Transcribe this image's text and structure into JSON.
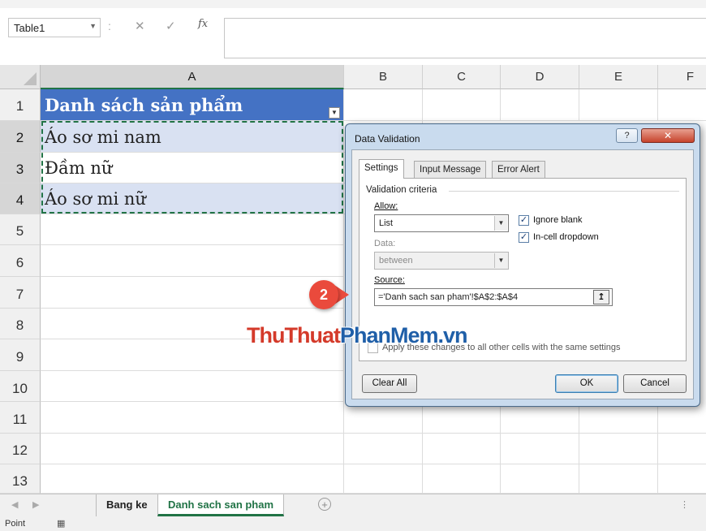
{
  "formula_bar": {
    "name_box": "Table1",
    "separator": ":",
    "cancel_glyph": "✕",
    "enter_glyph": "✓",
    "fx_label": "fx",
    "formula": ""
  },
  "columns": [
    "A",
    "B",
    "C",
    "D",
    "E",
    "F"
  ],
  "rows": [
    "1",
    "2",
    "3",
    "4",
    "5",
    "6",
    "7",
    "8",
    "9",
    "10",
    "11",
    "12",
    "13"
  ],
  "cells": {
    "a1": "Danh sách sản phẩm",
    "a2": "Áo sơ mi nam",
    "a3": "Đầm nữ",
    "a4": "Áo sơ mi nữ"
  },
  "sheet_tabs": [
    "Bang ke",
    "Danh sach san pham"
  ],
  "status": {
    "mode": "Point"
  },
  "dialog": {
    "title": "Data Validation",
    "help": "?",
    "close": "✕",
    "tabs": [
      "Settings",
      "Input Message",
      "Error Alert"
    ],
    "group_label": "Validation criteria",
    "allow_label": "Allow:",
    "allow_value": "List",
    "ignore_blank": "Ignore blank",
    "in_cell_dropdown": "In-cell dropdown",
    "data_label": "Data:",
    "data_value": "between",
    "source_label": "Source:",
    "source_value": "='Danh sach san pham'!$A$2:$A$4",
    "apply_label": "Apply these changes to all other cells with the same settings",
    "clear_all": "Clear All",
    "ok": "OK",
    "cancel": "Cancel"
  },
  "annotation": {
    "step": "2"
  },
  "watermark": {
    "part1": "ThuThuat",
    "part2": "PhanMem",
    "part3": ".vn"
  },
  "colors": {
    "header_fill": "#4472c4",
    "band_fill": "#d9e1f2",
    "excel_green": "#217346",
    "badge": "#ea4a3c"
  }
}
